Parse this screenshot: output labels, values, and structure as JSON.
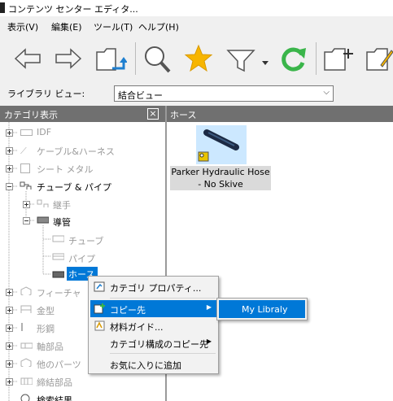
{
  "window": {
    "title": "コンテンツ センター エディタ..."
  },
  "menu": [
    "表示(V)",
    "編集(E)",
    "ツール(T)",
    "ヘルプ(H)"
  ],
  "toolbar": {
    "buttons": [
      "back-arrow-icon",
      "forward-arrow-icon",
      "folder-up-icon",
      "search-icon",
      "favorite-star-icon",
      "filter-icon",
      "dropdown-arrow-icon",
      "refresh-icon",
      "new-folder-icon",
      "edit-folder-icon"
    ],
    "colors": {
      "star": "#f7b500",
      "refresh": "#3ab54a",
      "up_arrow": "#1e7fd0"
    }
  },
  "library": {
    "label": "ライブラリ ビュー:",
    "selected": "結合ビュー"
  },
  "left_panel": {
    "title": "カテゴリ表示",
    "close": "×"
  },
  "right_panel": {
    "title": "ホース"
  },
  "tree": [
    {
      "label": "IDF",
      "enabled": false
    },
    {
      "label": "ケーブル&ハーネス",
      "enabled": false
    },
    {
      "label": "シート メタル",
      "enabled": false
    },
    {
      "label": "チューブ & パイプ",
      "enabled": true
    },
    {
      "label": "継手",
      "enabled": false
    },
    {
      "label": "導管",
      "enabled": true
    },
    {
      "label": "チューブ",
      "enabled": false
    },
    {
      "label": "パイプ",
      "enabled": false
    },
    {
      "label": "ホース",
      "enabled": true,
      "selected": true
    },
    {
      "label": "フィーチャ",
      "enabled": false
    },
    {
      "label": "金型",
      "enabled": false
    },
    {
      "label": "形鋼",
      "enabled": false
    },
    {
      "label": "軸部品",
      "enabled": false
    },
    {
      "label": "他のパーツ",
      "enabled": false
    },
    {
      "label": "締結部品",
      "enabled": false
    },
    {
      "label": "検索結果",
      "enabled": true
    }
  ],
  "items": [
    {
      "caption_line1": "Parker Hydraulic Hose",
      "caption_line2": "- No Skive"
    }
  ],
  "context_menu": {
    "items": [
      {
        "label": "カテゴリ プロパティ..."
      },
      {
        "label": "コピー先",
        "submenu": true,
        "highlighted": true
      },
      {
        "label": "材料ガイド..."
      },
      {
        "label": "カテゴリ構成のコピー先",
        "submenu": true
      },
      {
        "label": "お気に入りに追加"
      }
    ],
    "submenu_arrow": "▶"
  },
  "submenu": {
    "items": [
      "My Libraly"
    ]
  }
}
